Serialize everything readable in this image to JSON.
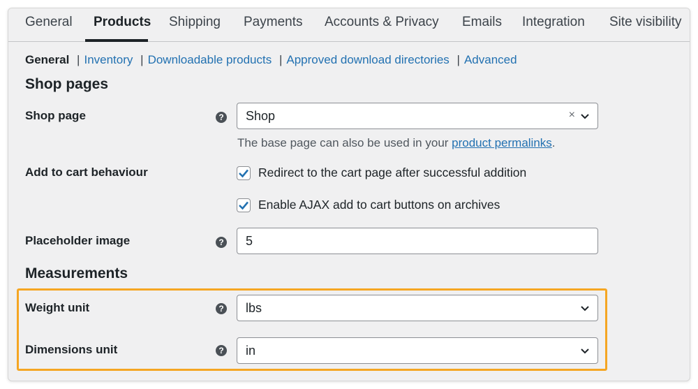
{
  "tabs": [
    {
      "label": "General"
    },
    {
      "label": "Products"
    },
    {
      "label": "Shipping"
    },
    {
      "label": "Payments"
    },
    {
      "label": "Accounts & Privacy"
    },
    {
      "label": "Emails"
    },
    {
      "label": "Integration"
    },
    {
      "label": "Site visibility"
    }
  ],
  "active_tab": "Products",
  "subnav": {
    "current": "General",
    "separator": "|",
    "links": [
      "Inventory",
      "Downloadable products",
      "Approved download directories",
      "Advanced"
    ]
  },
  "sections": {
    "shop_pages": "Shop pages",
    "measurements": "Measurements"
  },
  "fields": {
    "shop_page": {
      "label": "Shop page",
      "value": "Shop",
      "clear_glyph": "×"
    },
    "shop_page_desc": {
      "text": "The base page can also be used in your ",
      "link": "product permalinks",
      "suffix": "."
    },
    "add_to_cart": {
      "label": "Add to cart behaviour",
      "options": [
        {
          "text": "Redirect to the cart page after successful addition",
          "checked": true
        },
        {
          "text": "Enable AJAX add to cart buttons on archives",
          "checked": true
        }
      ]
    },
    "placeholder_image": {
      "label": "Placeholder image",
      "value": "5"
    },
    "weight_unit": {
      "label": "Weight unit",
      "value": "lbs"
    },
    "dimensions_unit": {
      "label": "Dimensions unit",
      "value": "in"
    }
  },
  "help_glyph": "?",
  "colors": {
    "link": "#2271b1",
    "checkbox": "#2271b1",
    "highlight": "#f5a623",
    "background": "#f0f0f1"
  },
  "icons": {
    "help": "question-circle-icon",
    "dropdown": "chevron-down-icon",
    "check": "checkmark-icon",
    "clear": "clear-x-icon"
  }
}
